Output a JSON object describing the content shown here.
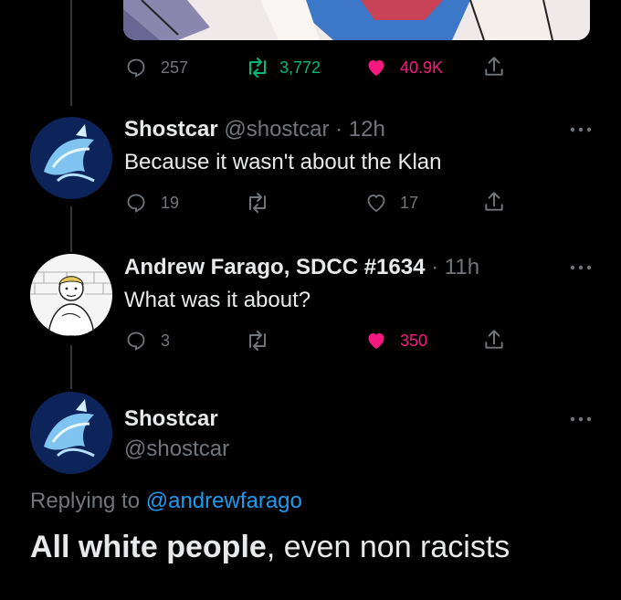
{
  "top_tweet": {
    "replies": "257",
    "retweets": "3,772",
    "likes": "40.9K"
  },
  "replies": [
    {
      "name": "Shostcar",
      "handle": "@shostcar",
      "sep": "·",
      "time": "12h",
      "text": "Because it wasn't about the Klan",
      "reply_count": "19",
      "like_count": "17",
      "liked": false
    },
    {
      "name": "Andrew Farago, SDCC #1634",
      "sep": "·",
      "time": "11h",
      "text": "What was it about?",
      "reply_count": "3",
      "like_count": "350",
      "liked": true
    }
  ],
  "focused": {
    "name": "Shostcar",
    "handle": "@shostcar",
    "replying_prefix": "Replying to",
    "replying_to": "@andrewfarago",
    "text_bold": "All white people",
    "text_rest": ", even non racists"
  },
  "colors": {
    "background": "#000000",
    "text": "#e7e9ea",
    "muted": "#71767b",
    "retweet_green": "#00ba7c",
    "like_pink": "#f91880",
    "link_blue": "#1d9bf0"
  },
  "icons": [
    "reply-icon",
    "retweet-icon",
    "heart-icon",
    "share-icon",
    "more-icon"
  ]
}
